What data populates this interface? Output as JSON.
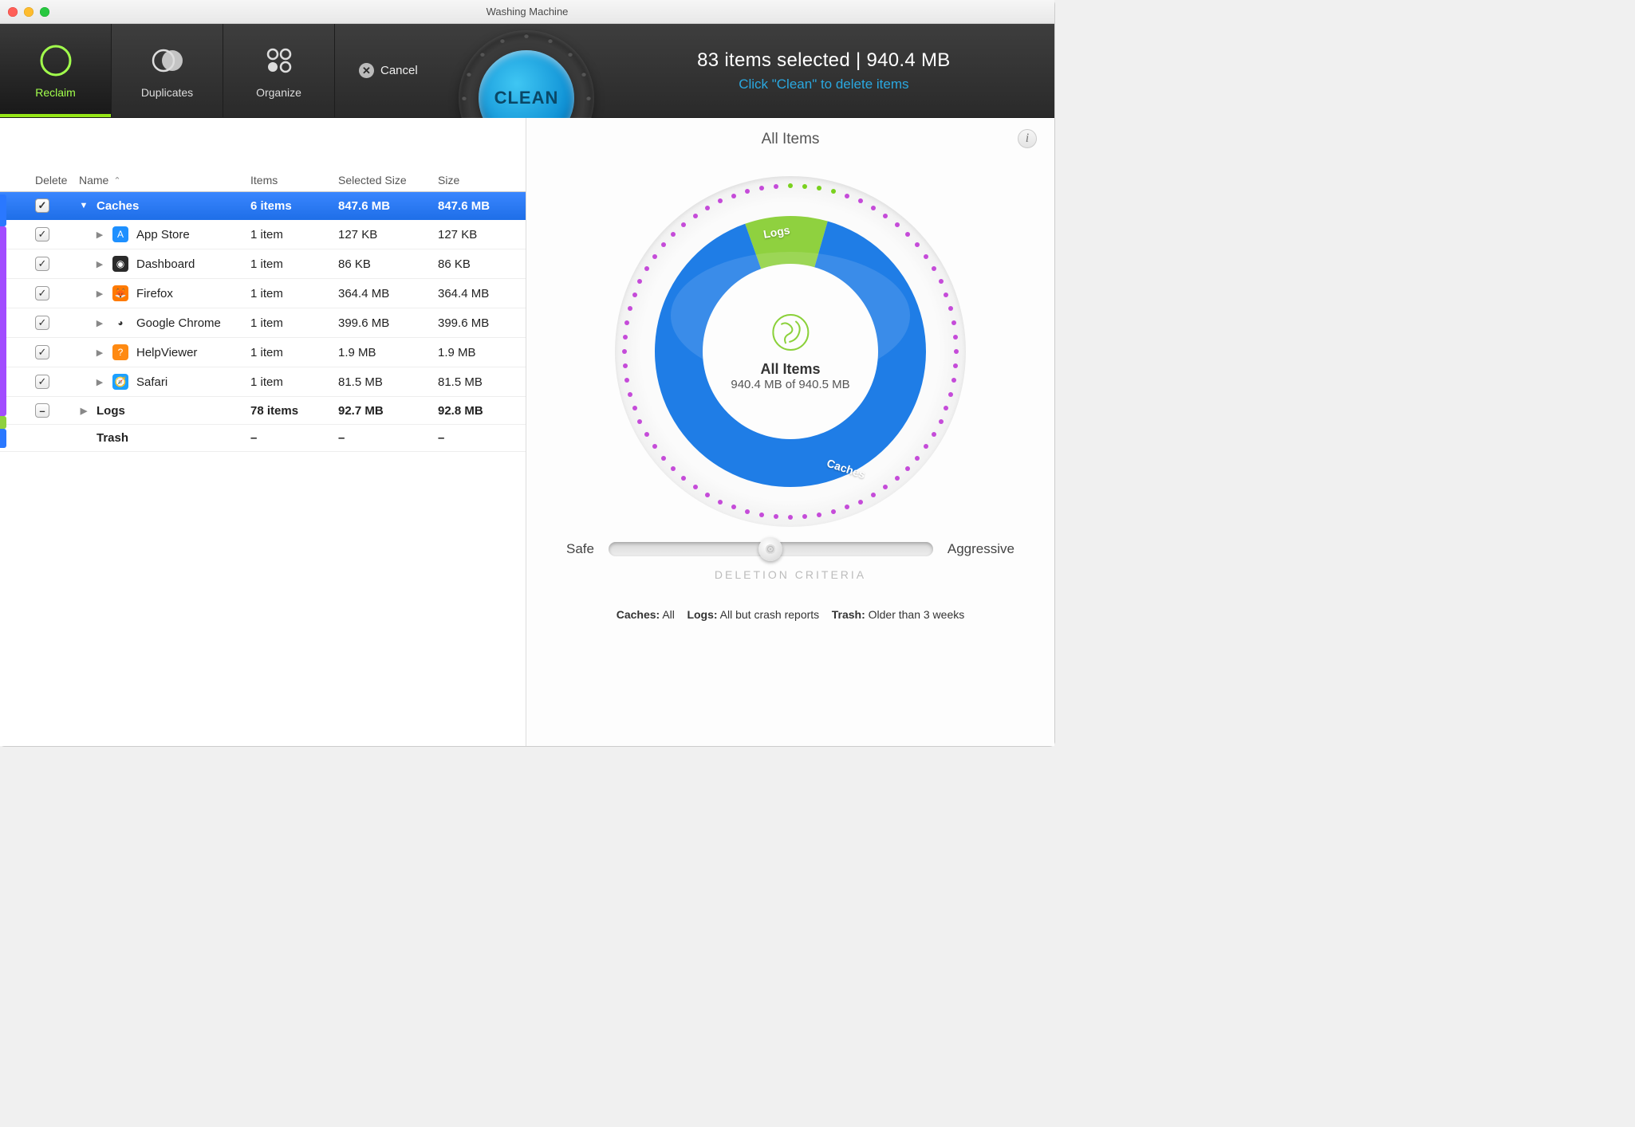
{
  "window": {
    "title": "Washing Machine"
  },
  "toolbar": {
    "tabs": [
      {
        "label": "Reclaim",
        "icon": "moon-green"
      },
      {
        "label": "Duplicates",
        "icon": "circles-overlap"
      },
      {
        "label": "Organize",
        "icon": "grid-dots"
      }
    ],
    "cancel_label": "Cancel",
    "clean_label": "CLEAN",
    "summary_title": "83 items selected | 940.4 MB",
    "summary_sub": "Click \"Clean\" to delete items"
  },
  "columns": {
    "del": "Delete",
    "name": "Name",
    "items": "Items",
    "ssize": "Selected Size",
    "size": "Size"
  },
  "sidebar_colors": {
    "caches": "#2a78ff",
    "logs": "#9add1e",
    "trash": "#a24cff"
  },
  "rows": [
    {
      "type": "group",
      "selected": true,
      "check": "on",
      "open": true,
      "name": "Caches",
      "items": "6 items",
      "ssize": "847.6 MB",
      "size": "847.6 MB"
    },
    {
      "type": "child",
      "check": "on",
      "name": "App Store",
      "icon_bg": "#1e90ff",
      "icon_txt": "A",
      "items": "1 item",
      "ssize": "127 KB",
      "size": "127 KB"
    },
    {
      "type": "child",
      "check": "on",
      "name": "Dashboard",
      "icon_bg": "#2a2a2a",
      "icon_txt": "◉",
      "items": "1 item",
      "ssize": "86 KB",
      "size": "86 KB"
    },
    {
      "type": "child",
      "check": "on",
      "name": "Firefox",
      "icon_bg": "#ff7a00",
      "icon_txt": "🦊",
      "items": "1 item",
      "ssize": "364.4 MB",
      "size": "364.4 MB"
    },
    {
      "type": "child",
      "check": "on",
      "name": "Google Chrome",
      "icon_bg": "#ffffff",
      "icon_txt": "◕",
      "items": "1 item",
      "ssize": "399.6 MB",
      "size": "399.6 MB"
    },
    {
      "type": "child",
      "check": "on",
      "name": "HelpViewer",
      "icon_bg": "#ff8a12",
      "icon_txt": "?",
      "items": "1 item",
      "ssize": "1.9 MB",
      "size": "1.9 MB"
    },
    {
      "type": "child",
      "check": "on",
      "name": "Safari",
      "icon_bg": "#1ca0ff",
      "icon_txt": "🧭",
      "items": "1 item",
      "ssize": "81.5 MB",
      "size": "81.5 MB"
    },
    {
      "type": "group",
      "selected": false,
      "check": "mixed",
      "open": false,
      "name": "Logs",
      "items": "78 items",
      "ssize": "92.7 MB",
      "size": "92.8 MB"
    },
    {
      "type": "group",
      "selected": false,
      "check": "none",
      "open": null,
      "name": "Trash",
      "items": "–",
      "ssize": "–",
      "size": "–"
    }
  ],
  "right": {
    "title": "All Items",
    "center_title": "All Items",
    "center_sub": "940.4 MB of 940.5 MB",
    "segment_caches": "Caches",
    "segment_logs": "Logs",
    "slider_left": "Safe",
    "slider_right": "Aggressive",
    "criteria_label": "DELETION CRITERIA",
    "criteria": [
      {
        "k": "Caches:",
        "v": "All"
      },
      {
        "k": "Logs:",
        "v": "All but crash reports"
      },
      {
        "k": "Trash:",
        "v": "Older than 3 weeks"
      }
    ]
  },
  "chart_data": {
    "type": "pie",
    "title": "All Items",
    "series": [
      {
        "name": "Caches",
        "value": 847.6,
        "color": "#1f7de6"
      },
      {
        "name": "Logs",
        "value": 92.7,
        "color": "#8fd13f"
      }
    ],
    "total_selected": "940.4 MB",
    "total_available": "940.5 MB"
  }
}
